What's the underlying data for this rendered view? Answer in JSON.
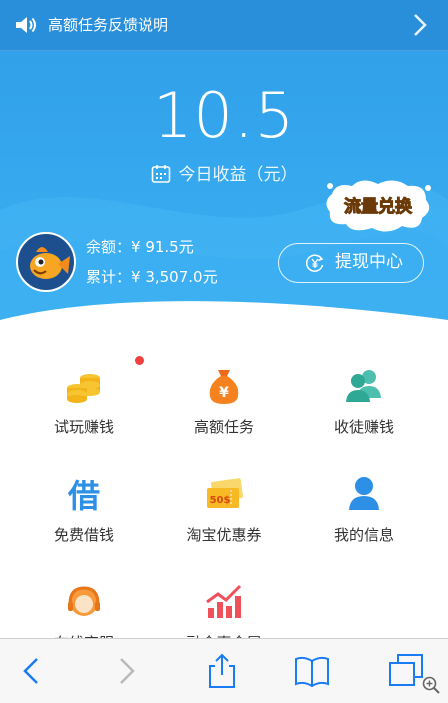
{
  "notice": {
    "text": "高额任务反馈说明"
  },
  "earnings": {
    "amount": "10.5",
    "label": "今日收益（元）"
  },
  "exchange_badge": {
    "text": "流量兑换"
  },
  "account": {
    "balance_label": "余额：",
    "balance": "¥ 91.5元",
    "total_label": "累计：",
    "total": "¥ 3,507.0元"
  },
  "withdraw": {
    "label": "提现中心"
  },
  "menu": [
    {
      "label": "试玩赚钱",
      "icon": "coins-icon",
      "badge": true
    },
    {
      "label": "高额任务",
      "icon": "money-bag-icon"
    },
    {
      "label": "收徒赚钱",
      "icon": "users-icon"
    },
    {
      "label": "免费借钱",
      "icon": "borrow-icon"
    },
    {
      "label": "淘宝优惠券",
      "icon": "coupon-icon"
    },
    {
      "label": "我的信息",
      "icon": "user-icon"
    },
    {
      "label": "在线客服",
      "icon": "headset-icon"
    },
    {
      "label": "融金惠金屋",
      "icon": "chart-icon"
    }
  ],
  "colors": {
    "primary": "#36a9ef",
    "accent": "#2a8fda",
    "badge": "#f04040",
    "toolbar_icon": "#1a7cf5"
  }
}
